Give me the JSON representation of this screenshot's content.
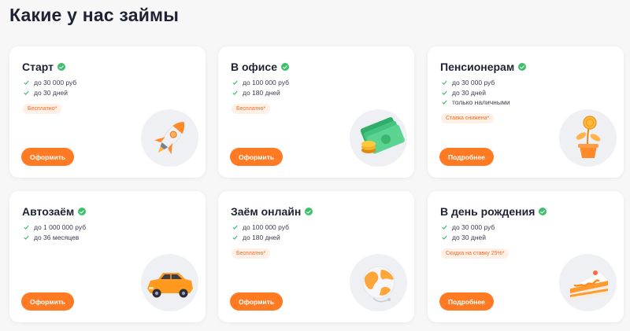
{
  "page": {
    "title": "Какие у нас займы"
  },
  "colors": {
    "accent": "#ff7a22",
    "check": "#3fbf6e",
    "tag_bg": "#fff0e6",
    "tag_text": "#f26b2b"
  },
  "cards": [
    {
      "title": "Старт",
      "features": [
        "до 30 000 руб",
        "до 30 дней"
      ],
      "tag": "Бесплатно*",
      "button": "Оформить",
      "icon": "rocket-icon"
    },
    {
      "title": "В офисе",
      "features": [
        "до 100 000 руб",
        "до 180 дней"
      ],
      "tag": "Бесплатно*",
      "button": "Оформить",
      "icon": "money-stack-icon"
    },
    {
      "title": "Пенсионерам",
      "features": [
        "до 30 000 руб",
        "до 30 дней",
        "только наличными"
      ],
      "tag": "Ставка снижена*",
      "button": "Подробнее",
      "icon": "coin-plant-icon"
    },
    {
      "title": "Автозаём",
      "features": [
        "до 1 000 000 руб",
        "до 36 месяцев"
      ],
      "tag": "",
      "button": "Оформить",
      "icon": "car-icon"
    },
    {
      "title": "Заём онлайн",
      "features": [
        "до 100 000 руб",
        "до 180 дней"
      ],
      "tag": "Бесплатно*",
      "button": "Оформить",
      "icon": "globe-icon"
    },
    {
      "title": "В день рождения",
      "features": [
        "до 30 000 руб",
        "до 30 дней"
      ],
      "tag": "Скидка на ставку 25%*",
      "button": "Подробнее",
      "icon": "cake-icon"
    }
  ]
}
